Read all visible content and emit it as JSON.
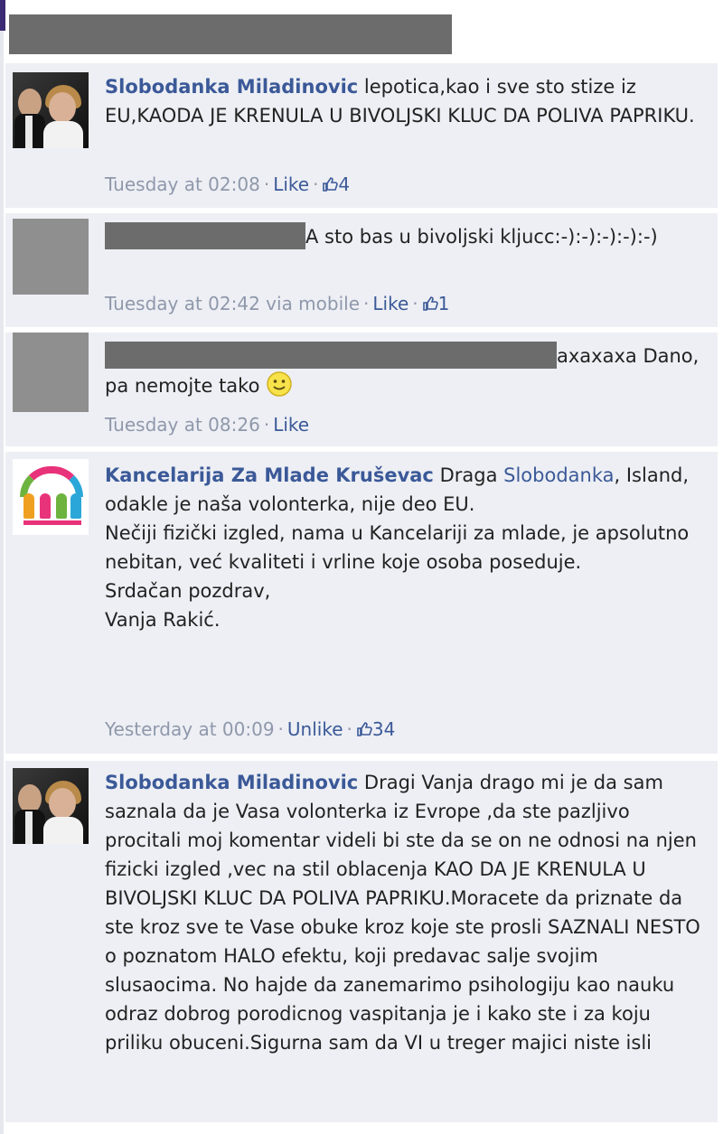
{
  "comments": [
    {
      "author": "Slobodanka Miladinovic",
      "text": "lepotica,kao i sve sto stize iz EU,KAODA JE KRENULA U BIVOLJSKI KLUC DA POLIVA PAPRIKU.",
      "time": "Tuesday at 02:08",
      "action": "Like",
      "likes": "4"
    },
    {
      "author": "",
      "text": "A sto bas u bivoljski kljucc:-):-):-):-):-)",
      "time": "Tuesday at 02:42 via mobile",
      "action": "Like",
      "likes": "1"
    },
    {
      "author": "",
      "text_before": "axaxaxa",
      "text_after": "Dano, pa nemojte tako",
      "time": "Tuesday at 08:26",
      "action": "Like"
    },
    {
      "author": "Kancelarija Za Mlade Kruševac",
      "text_intro": "Draga",
      "mention": "Slobodanka",
      "text": ", Island, odakle je naša volonterka, nije deo EU.",
      "paragraph2": "Nečiji fizički izgled, nama u Kancelariji za mlade, je apsolutno nebitan, već kvaliteti i vrline koje osoba poseduje.",
      "closing": "Srdačan pozdrav,",
      "signature": "Vanja Rakić.",
      "time": "Yesterday at 00:09",
      "action": "Unlike",
      "likes": "34"
    },
    {
      "author": "Slobodanka Miladinovic",
      "text": "Dragi Vanja drago mi je da sam saznala da je Vasa volonterka iz Evrope ,da ste pazljivo procitali moj komentar videli bi ste da se on ne odnosi na njen fizicki izgled ,vec na stil oblacenja KAO DA JE KRENULA U BIVOLJSKI KLUC DA POLIVA PAPRIKU.Moracete da priznate da ste kroz sve te Vase obuke kroz koje ste prosli SAZNALI NESTO o poznatom HALO efektu, koji predavac salje svojim slusaocima. No hajde da zanemarimo psihologiju kao nauku odraz dobrog porodicnog vaspitanja je i kako ste i za koju priliku obuceni.Sigurna sam da VI u treger majici niste isli"
    }
  ],
  "icons": {
    "like": "thumbs-up-icon",
    "emoji": "smiley-icon"
  },
  "colors": {
    "link": "#3b5998",
    "meta": "#8f98ab",
    "comment_bg": "#edeff4",
    "redaction": "#6c6c6c"
  }
}
